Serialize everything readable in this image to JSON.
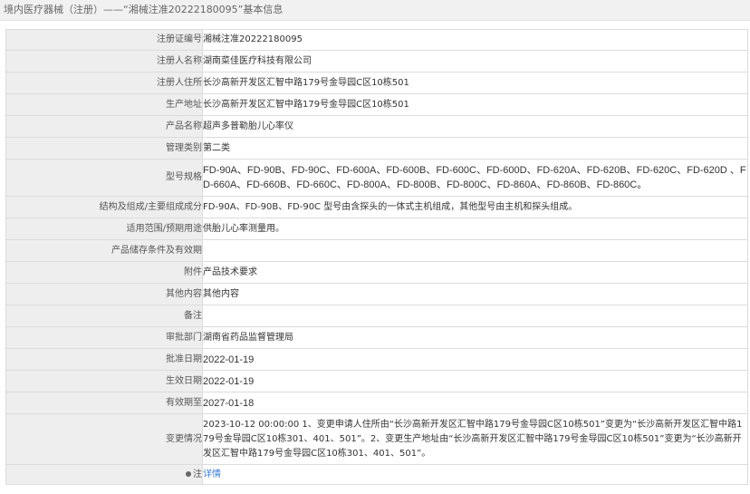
{
  "header": {
    "title": "境内医疗器械（注册）——“湘械注准20222180095”基本信息"
  },
  "rows": [
    {
      "label": "注册证编号",
      "value": "湘械注准20222180095"
    },
    {
      "label": "注册人名称",
      "value": "湖南菜佳医疗科技有限公司"
    },
    {
      "label": "注册人住所",
      "value": "长沙高新开发区汇智中路179号金导园C区10栋501"
    },
    {
      "label": "生产地址",
      "value": "长沙高新开发区汇智中路179号金导园C区10栋501"
    },
    {
      "label": "产品名称",
      "value": "超声多普勒胎儿心率仪"
    },
    {
      "label": "管理类别",
      "value": "第二类"
    },
    {
      "label": "型号规格",
      "value": "FD-90A、FD-90B、FD-90C、FD-600A、FD-600B、FD-600C、FD-600D、FD-620A、FD-620B、FD-620C、FD-620D 、FD-660A、FD-660B、FD-660C、FD-800A、FD-800B、FD-800C、FD-860A、FD-860B、FD-860C。"
    },
    {
      "label": "结构及组成/主要组成成分",
      "value": "FD-90A、FD-90B、FD-90C 型号由含探头的一体式主机组成，其他型号由主机和探头组成。"
    },
    {
      "label": "适用范围/预期用途",
      "value": "供胎儿心率测量用。"
    },
    {
      "label": "产品储存条件及有效期",
      "value": ""
    },
    {
      "label": "附件",
      "value": "产品技术要求"
    },
    {
      "label": "其他内容",
      "value": "其他内容"
    },
    {
      "label": "备注",
      "value": ""
    },
    {
      "label": "审批部门",
      "value": "湖南省药品监督管理局"
    },
    {
      "label": "批准日期",
      "value": "2022-01-19"
    },
    {
      "label": "生效日期",
      "value": "2022-01-19"
    },
    {
      "label": "有效期至",
      "value": "2027-01-18"
    },
    {
      "label": "变更情况",
      "value": "2023-10-12 00:00:00 1、变更申请人住所由“长沙高新开发区汇智中路179号金导园C区10栋501”变更为“长沙高新开发区汇智中路179号金导园C区10栋301、401、501”。2、变更生产地址由“长沙高新开发区汇智中路179号金导园C区10栋501”变更为“长沙高新开发区汇智中路179号金导园C区10栋301、401、501”。"
    }
  ],
  "footer_row": {
    "label": "注",
    "icon": "location-pin-icon",
    "link_text": "详情"
  }
}
